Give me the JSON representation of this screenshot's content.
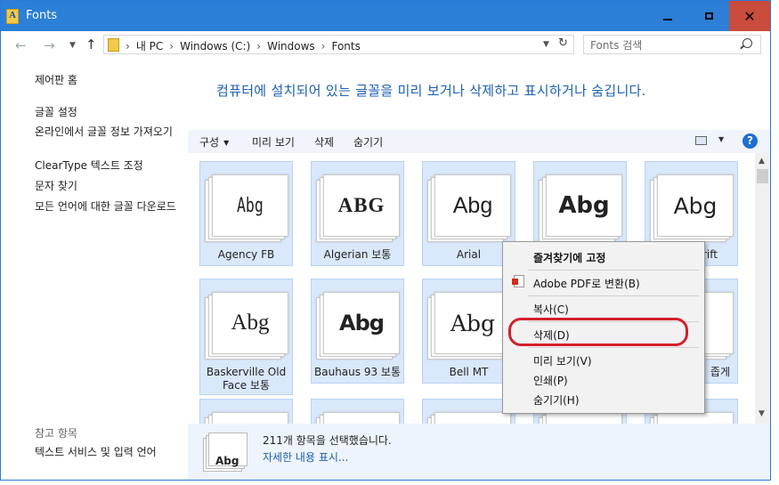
{
  "window": {
    "title": "Fonts"
  },
  "titlebar": {
    "close_glyph": "✕"
  },
  "address": {
    "crumbs": [
      "내 PC",
      "Windows (C:)",
      "Windows",
      "Fonts"
    ],
    "search_placeholder": "Fonts 검색"
  },
  "sidebar": {
    "control_panel_home": "제어판 홈",
    "links": [
      "글꼴 설정",
      "온라인에서 글꼴 정보 가져오기",
      "ClearType 텍스트 조정",
      "문자 찾기",
      "모든 언어에 대한 글꼴 다운로드"
    ],
    "see_also_heading": "참고 항목",
    "see_also_links": [
      "텍스트 서비스 및 입력 언어"
    ]
  },
  "main": {
    "headline": "컴퓨터에 설치되어 있는 글꼴을 미리 보거나 삭제하고 표시하거나 숨깁니다."
  },
  "toolbar": {
    "organize": "구성",
    "preview": "미리 보기",
    "delete": "삭제",
    "hide": "숨기기",
    "help": "?"
  },
  "fonts": [
    {
      "sample": "Abg",
      "name": "Agency FB"
    },
    {
      "sample": "ABG",
      "name": "Algerian 보통"
    },
    {
      "sample": "Abg",
      "name": "Arial"
    },
    {
      "sample": "Abg",
      "name": ""
    },
    {
      "sample": "Abg",
      "name": "rift"
    },
    {
      "sample": "Abg",
      "name": "Baskerville Old Face 보통"
    },
    {
      "sample": "Abg",
      "name": "Bauhaus 93 보통"
    },
    {
      "sample": "Abg",
      "name": "Bell MT"
    },
    {
      "sample": "",
      "name": ""
    },
    {
      "sample": "",
      "name": "좁게"
    }
  ],
  "details": {
    "sample": "Abg",
    "selected_count": "211개 항목을 선택했습니다.",
    "more_link": "자세한 내용 표시..."
  },
  "context_menu": {
    "items": [
      "즐겨찾기에 고정",
      "Adobe PDF로 변환(B)",
      "복사(C)",
      "삭제(D)",
      "미리 보기(V)",
      "인쇄(P)",
      "숨기기(H)"
    ]
  },
  "colors": {
    "titlebar": "#2b7fd6",
    "accent": "#1b5fb4",
    "selection": "#d9e8fa",
    "highlight": "#d4202b"
  }
}
